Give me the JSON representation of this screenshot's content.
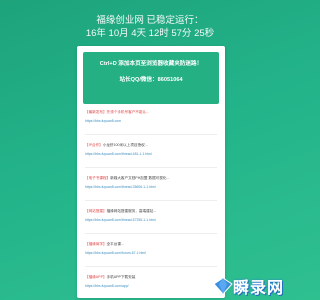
{
  "header": {
    "title": "福缘创业网 已稳定运行：",
    "runtime": "16年 10月 4天 12时 57分 25秒"
  },
  "banner": {
    "line1": "Ctrl+D 添加本页至浏览器收藏夹防迷路！",
    "line2": "站长QQ/微信：86051064"
  },
  "items": [
    {
      "tag": "",
      "title": "【最新发布】先领个手机号客户不能认...",
      "url": "https://bbs.fuyuan8.com"
    },
    {
      "tag": "【IP合作】",
      "title": "小龙虾100米以上项目授权...",
      "url": "https://bbs.fuyuan8.com/thread-481-1-1.html"
    },
    {
      "tag": "【电子书课程】",
      "title": "新媒大客户文档PH加盟 数据可视化...",
      "url": "https://bbs.fuyuan8.com/thread-35606-1-1.html"
    },
    {
      "tag": "【网站搭建】",
      "title": "福缘网站搭建服务，高端建站...",
      "url": "https://bbs.fuyuan8.com/thread-57255-1-1.html"
    },
    {
      "tag": "【福缘商学】",
      "title": "全平台课...",
      "url": "https://bbs.fuyuan8.com/forum-67-1.html"
    },
    {
      "tag": "【福缘APP】",
      "title": "手机APP下载安装",
      "url": "https://bbs.fuyuan8.com/app/"
    }
  ],
  "watermark": {
    "text": "瞬录网",
    "icon": "diamond-logo-icon",
    "colors": {
      "text_shadow": "#2b7fd6"
    }
  },
  "colors": {
    "background": "#23b38a",
    "banner": "#25b084",
    "link": "#3a8fbf",
    "highlight": "#e04646"
  }
}
